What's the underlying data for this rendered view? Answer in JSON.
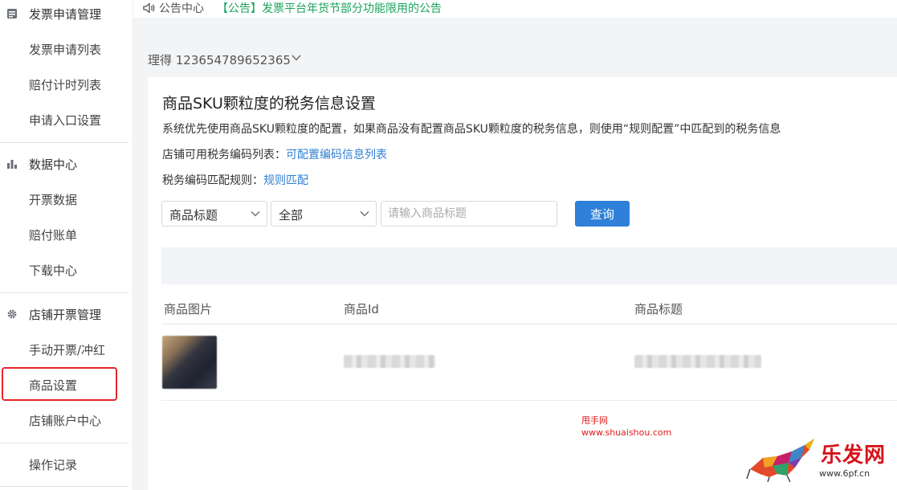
{
  "sidebar": {
    "groups": [
      {
        "label": "发票申请管理",
        "icon": "list-icon",
        "items": [
          "发票申请列表",
          "赔付计时列表",
          "申请入口设置"
        ]
      },
      {
        "label": "数据中心",
        "icon": "bar-chart-icon",
        "items": [
          "开票数据",
          "赔付账单",
          "下载中心"
        ]
      },
      {
        "label": "店铺开票管理",
        "icon": "gear-icon",
        "items": [
          "手动开票/冲红",
          "商品设置",
          "店铺账户中心"
        ]
      }
    ],
    "bottom_item": "操作记录",
    "active_item": "商品设置"
  },
  "notice": {
    "title": "公告中心",
    "link": "【公告】发票平台年货节部分功能限用的公告"
  },
  "account": {
    "label": "理得 123654789652365"
  },
  "main": {
    "title": "商品SKU颗粒度的税务信息设置",
    "description": "系统优先使用商品SKU颗粒度的配置，如果商品没有配置商品SKU颗粒度的税务信息，则使用“规则配置”中匹配到的税务信息",
    "code_list_label": "店铺可用税务编码列表：",
    "code_list_link": "可配置编码信息列表",
    "match_rule_label": "税务编码匹配规则：",
    "match_rule_link": "规则匹配",
    "filter": {
      "field_select": "商品标题",
      "scope_select": "全部",
      "search_placeholder": "请输入商品标题",
      "query_button": "查询"
    },
    "table": {
      "columns": [
        "商品图片",
        "商品Id",
        "商品标题"
      ]
    }
  },
  "watermark": {
    "line1": "甩手网",
    "line2": "www.shuaishou.com",
    "logo_text": "乐发网",
    "logo_url": "www.6pf.cn"
  },
  "colors": {
    "accent": "#2f80d8",
    "notice_green": "#1aa35d",
    "highlight_red": "#e8262b"
  }
}
